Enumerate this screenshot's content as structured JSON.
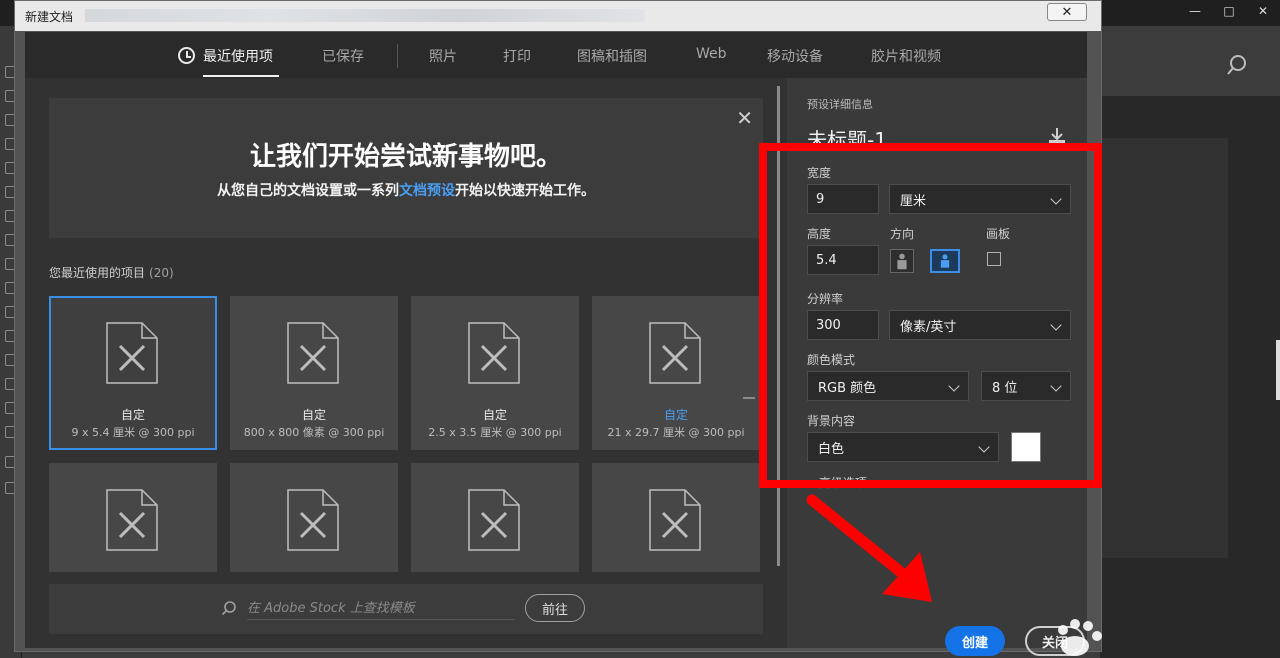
{
  "window": {
    "title": "新建文档",
    "close_glyph": "✕"
  },
  "background_app": {
    "win_controls": [
      "—",
      "□",
      "✕"
    ]
  },
  "tabs": [
    {
      "label": "最近使用项",
      "active": true
    },
    {
      "label": "已保存"
    },
    {
      "label": "照片"
    },
    {
      "label": "打印"
    },
    {
      "label": "图稿和插图"
    },
    {
      "label": "Web"
    },
    {
      "label": "移动设备"
    },
    {
      "label": "胶片和视频"
    }
  ],
  "banner": {
    "close_glyph": "✕",
    "title": "让我们开始尝试新事物吧。",
    "subtitle_pre": "从您自己的文档设置或一系列",
    "subtitle_link": "文档预设",
    "subtitle_post": "开始以快速开始工作。"
  },
  "recent": {
    "label": "您最近使用的项目",
    "count": "(20)",
    "items": [
      {
        "name": "自定",
        "size": "9 x 5.4 厘米 @ 300 ppi",
        "selected": true
      },
      {
        "name": "自定",
        "size": "800 x 800 像素 @ 300 ppi"
      },
      {
        "name": "自定",
        "size": "2.5 x 3.5 厘米 @ 300 ppi"
      },
      {
        "name": "自定",
        "size": "21 x 29.7 厘米 @ 300 ppi",
        "highlight": true
      },
      {
        "name": "",
        "size": ""
      },
      {
        "name": "",
        "size": ""
      },
      {
        "name": "",
        "size": ""
      },
      {
        "name": "",
        "size": ""
      }
    ]
  },
  "stock": {
    "placeholder": "在 Adobe Stock 上查找模板",
    "go_label": "前往"
  },
  "preset": {
    "section_label": "预设详细信息",
    "doc_title": "未标题-1",
    "width_label": "宽度",
    "width_value": "9",
    "width_unit": "厘米",
    "height_label": "高度",
    "height_value": "5.4",
    "orientation_label": "方向",
    "artboard_label": "画板",
    "resolution_label": "分辨率",
    "resolution_value": "300",
    "resolution_unit": "像素/英寸",
    "color_mode_label": "颜色模式",
    "color_mode": "RGB 颜色",
    "bit_depth": "8 位",
    "background_label": "背景内容",
    "background_value": "白色",
    "background_color": "#ffffff",
    "advanced_label": "▸ 高级选项"
  },
  "actions": {
    "create_label": "创建",
    "close_label": "关闭"
  },
  "colors": {
    "accent": "#1473e6",
    "link": "#4a9ff5",
    "annotation": "#ff0000"
  }
}
